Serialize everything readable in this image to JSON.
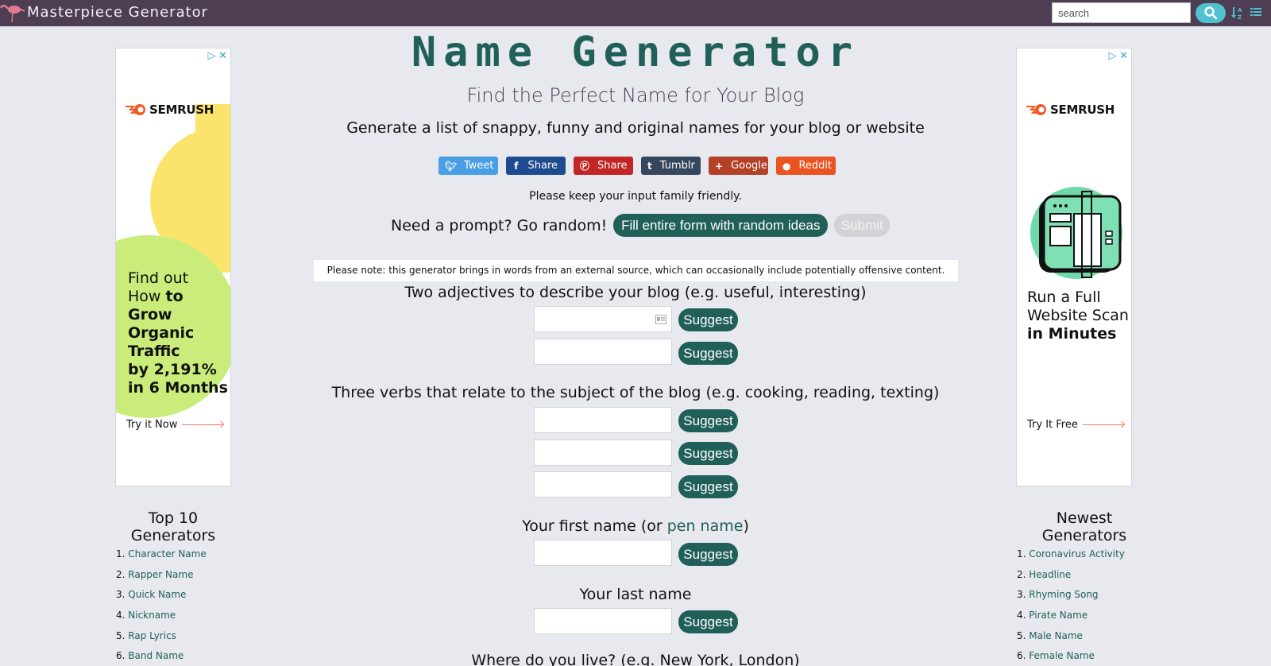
{
  "topbar": {
    "brand": "Masterpiece Generator",
    "search_placeholder": "search"
  },
  "header": {
    "title": "Name Generator",
    "subtitle": "Find the Perfect Name for Your Blog",
    "description": "Generate a list of snappy, funny and original names for your blog or website"
  },
  "share": [
    {
      "label": "Tweet",
      "icon": "twitter-icon"
    },
    {
      "label": "Share",
      "icon": "facebook-icon"
    },
    {
      "label": "Share",
      "icon": "pinterest-icon"
    },
    {
      "label": "Tumblr",
      "icon": "tumblr-icon"
    },
    {
      "label": "Google",
      "icon": "plus-icon"
    },
    {
      "label": "Reddit",
      "icon": "reddit-icon"
    }
  ],
  "form": {
    "family_note": "Please keep your input family friendly.",
    "prompt_label": "Need a prompt? Go random!",
    "random_button": "Fill entire form with random ideas",
    "submit_button": "Submit",
    "offensive_note": "Please note: this generator brings in words from an external source, which can occasionally include potentially offensive content.",
    "suggest_label": "Suggest",
    "adjectives_label": "Two adjectives to describe your blog (e.g. useful, interesting)",
    "verbs_label": "Three verbs that relate to the subject of the blog (e.g. cooking, reading, texting)",
    "first_name_label_pre": "Your first name (or ",
    "first_name_link": "pen name",
    "first_name_label_post": ")",
    "last_name_label": "Your last name",
    "location_label": "Where do you live? (e.g. New York, London)",
    "values": {
      "adjective_1": "",
      "adjective_2": "",
      "verb_1": "",
      "verb_2": "",
      "verb_3": "",
      "first_name": "",
      "last_name": ""
    }
  },
  "ads": {
    "left": {
      "brand": "SEMRUSH",
      "line1": "Find out",
      "line2_pre": "How ",
      "line2_bold": "to Grow",
      "line3": "Organic",
      "line4": "Traffic",
      "line5": "by 2,191%",
      "line6": "in 6 Months",
      "cta": "Try it Now"
    },
    "right": {
      "brand": "SEMRUSH",
      "line1": "Run a Full",
      "line2": "Website Scan",
      "line3": "in Minutes",
      "cta": "Try It Free"
    }
  },
  "top10": {
    "heading_line1": "Top 10",
    "heading_line2": "Generators",
    "items": [
      "Character Name",
      "Rapper Name",
      "Quick Name",
      "Nickname",
      "Rap Lyrics",
      "Band Name"
    ]
  },
  "newest": {
    "heading_line1": "Newest",
    "heading_line2": "Generators",
    "items": [
      "Coronavirus Activity",
      "Headline",
      "Rhyming Song",
      "Pirate Name",
      "Male Name",
      "Female Name"
    ]
  },
  "colors": {
    "topbar": "#4e3e54",
    "accent": "#215f59",
    "search_button": "#4fc1cf",
    "background": "#e7e9ee"
  }
}
